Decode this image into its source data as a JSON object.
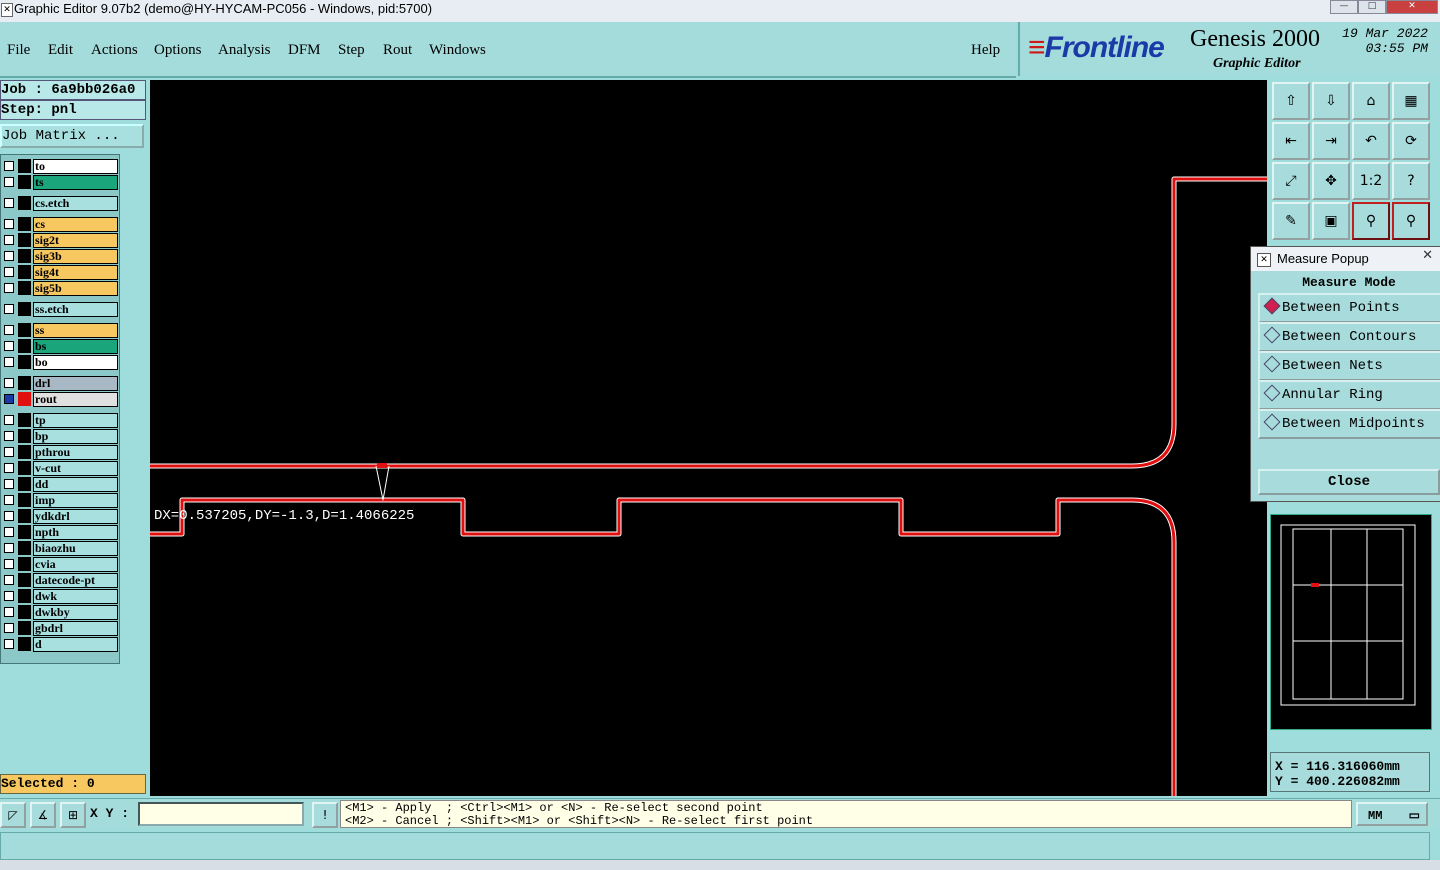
{
  "window": {
    "title": "Graphic Editor 9.07b2 (demo@HY-HYCAM-PC056 - Windows, pid:5700)"
  },
  "menu": {
    "items": [
      "File",
      "Edit",
      "Actions",
      "Options",
      "Analysis",
      "DFM",
      "Step",
      "Rout",
      "Windows"
    ],
    "help": "Help"
  },
  "brand": {
    "logo": "Frontline",
    "product": "Genesis 2000",
    "module": "Graphic Editor",
    "date": "19 Mar 2022",
    "time": "03:55 PM"
  },
  "job": {
    "job_line": "Job : 6a9bb026a0",
    "step_line": "Step: pnl",
    "matrix_button": "Job Matrix ..."
  },
  "layers": [
    {
      "name": "to",
      "color": "#ffffff"
    },
    {
      "name": "ts",
      "color": "#1aa57a"
    },
    {
      "name": "cs.etch",
      "color": "#a8e0e0"
    },
    {
      "name": "cs",
      "color": "#f8c860"
    },
    {
      "name": "sig2t",
      "color": "#f8c860"
    },
    {
      "name": "sig3b",
      "color": "#f8c860"
    },
    {
      "name": "sig4t",
      "color": "#f8c860"
    },
    {
      "name": "sig5b",
      "color": "#f8c860"
    },
    {
      "name": "ss.etch",
      "color": "#a8e0e0"
    },
    {
      "name": "ss",
      "color": "#f8c860"
    },
    {
      "name": "bs",
      "color": "#1aa57a"
    },
    {
      "name": "bo",
      "color": "#ffffff"
    },
    {
      "name": "drl",
      "color": "#a8b8c4"
    },
    {
      "name": "rout",
      "color": "#e0e0e0",
      "active": true,
      "swatch": "#e01010"
    },
    {
      "name": "tp",
      "color": "#a8e0e0"
    },
    {
      "name": "bp",
      "color": "#a8e0e0"
    },
    {
      "name": "pthrou",
      "color": "#a8e0e0"
    },
    {
      "name": "v-cut",
      "color": "#a8e0e0"
    },
    {
      "name": "dd",
      "color": "#a8e0e0"
    },
    {
      "name": "imp",
      "color": "#a8e0e0"
    },
    {
      "name": "ydkdrl",
      "color": "#a8e0e0"
    },
    {
      "name": "npth",
      "color": "#a8e0e0"
    },
    {
      "name": "biaozhu",
      "color": "#a8e0e0"
    },
    {
      "name": "cvia",
      "color": "#a8e0e0"
    },
    {
      "name": "datecode-pt",
      "color": "#a8e0e0"
    },
    {
      "name": "dwk",
      "color": "#a8e0e0"
    },
    {
      "name": "dwkby",
      "color": "#a8e0e0"
    },
    {
      "name": "gbdrl",
      "color": "#a8e0e0"
    },
    {
      "name": "d",
      "color": "#a8e0e0"
    }
  ],
  "selected": "Selected : 0",
  "canvas": {
    "measure_text": "DX=0.537205,DY=-1.3,D=1.4066225",
    "rout_color": "#e01010"
  },
  "measure_popup": {
    "title": "Measure Popup",
    "mode_label": "Measure Mode",
    "options": [
      "Between Points",
      "Between Contours",
      "Between Nets",
      "Annular Ring",
      "Between Midpoints"
    ],
    "selected_option": "Between Points",
    "close": "Close"
  },
  "coords": {
    "x": "X = 116.316060mm",
    "y": "Y = 400.226082mm"
  },
  "bottom": {
    "xy_label": "X Y :",
    "xy_value": "",
    "hint_line1": "<M1> - Apply  ; <Ctrl><M1> or <N> - Re-select second point",
    "hint_line2": "<M2> - Cancel ; <Shift><M1> or <Shift><N> - Re-select first point",
    "unit": "MM"
  },
  "toolbar": {
    "icons": [
      "step-up-icon",
      "step-down-icon",
      "home-icon",
      "panel-icon",
      "pan-left-icon",
      "pan-right-icon",
      "undo-icon",
      "redo-icon",
      "zoom-fit-icon",
      "zoom-center-icon",
      "scale-icon",
      "help-icon",
      "edit-tools-icon",
      "grid-icon",
      "measure-icon",
      "snap-icon"
    ],
    "glyphs": [
      "⇧",
      "⇩",
      "⌂",
      "▦",
      "⇤",
      "⇥",
      "↶",
      "⟳",
      "⤢",
      "✥",
      "1:2",
      "?",
      "✎",
      "▣",
      "⚲",
      "⚲"
    ]
  }
}
